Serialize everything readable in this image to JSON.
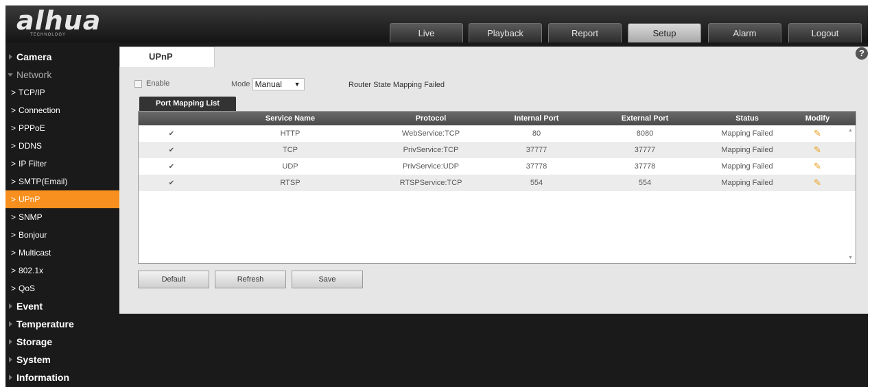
{
  "logo": {
    "text": "alhua",
    "sub": "TECHNOLOGY"
  },
  "nav": {
    "tabs": [
      {
        "label": "Live"
      },
      {
        "label": "Playback"
      },
      {
        "label": "Report"
      },
      {
        "label": "Setup"
      },
      {
        "label": "Alarm"
      },
      {
        "label": "Logout"
      }
    ],
    "active": "Setup"
  },
  "sidebar": {
    "camera": "Camera",
    "network": "Network",
    "sub": [
      {
        "label": "TCP/IP"
      },
      {
        "label": "Connection"
      },
      {
        "label": "PPPoE"
      },
      {
        "label": "DDNS"
      },
      {
        "label": "IP Filter"
      },
      {
        "label": "SMTP(Email)"
      },
      {
        "label": "UPnP"
      },
      {
        "label": "SNMP"
      },
      {
        "label": "Bonjour"
      },
      {
        "label": "Multicast"
      },
      {
        "label": "802.1x"
      },
      {
        "label": "QoS"
      }
    ],
    "event": "Event",
    "temperature": "Temperature",
    "storage": "Storage",
    "system": "System",
    "information": "Information"
  },
  "page": {
    "tab": "UPnP",
    "help": "?",
    "enable_label": "Enable",
    "mode_label": "Mode",
    "mode_value": "Manual",
    "router_state": "Router State Mapping Failed",
    "subtab": "Port Mapping List"
  },
  "table": {
    "headers": {
      "service": "Service Name",
      "protocol": "Protocol",
      "internal": "Internal Port",
      "external": "External Port",
      "status": "Status",
      "modify": "Modify"
    },
    "rows": [
      {
        "service": "HTTP",
        "protocol": "WebService:TCP",
        "internal": "80",
        "external": "8080",
        "status": "Mapping Failed"
      },
      {
        "service": "TCP",
        "protocol": "PrivService:TCP",
        "internal": "37777",
        "external": "37777",
        "status": "Mapping Failed"
      },
      {
        "service": "UDP",
        "protocol": "PrivService:UDP",
        "internal": "37778",
        "external": "37778",
        "status": "Mapping Failed"
      },
      {
        "service": "RTSP",
        "protocol": "RTSPService:TCP",
        "internal": "554",
        "external": "554",
        "status": "Mapping Failed"
      }
    ]
  },
  "buttons": {
    "default": "Default",
    "refresh": "Refresh",
    "save": "Save"
  },
  "colors": {
    "accent": "#f7901e",
    "header": "#1a1a1a",
    "content_bg": "#e6e6e6"
  },
  "icons": {
    "help": "help-icon",
    "edit": "pencil-icon",
    "check": "checkmark-icon"
  }
}
